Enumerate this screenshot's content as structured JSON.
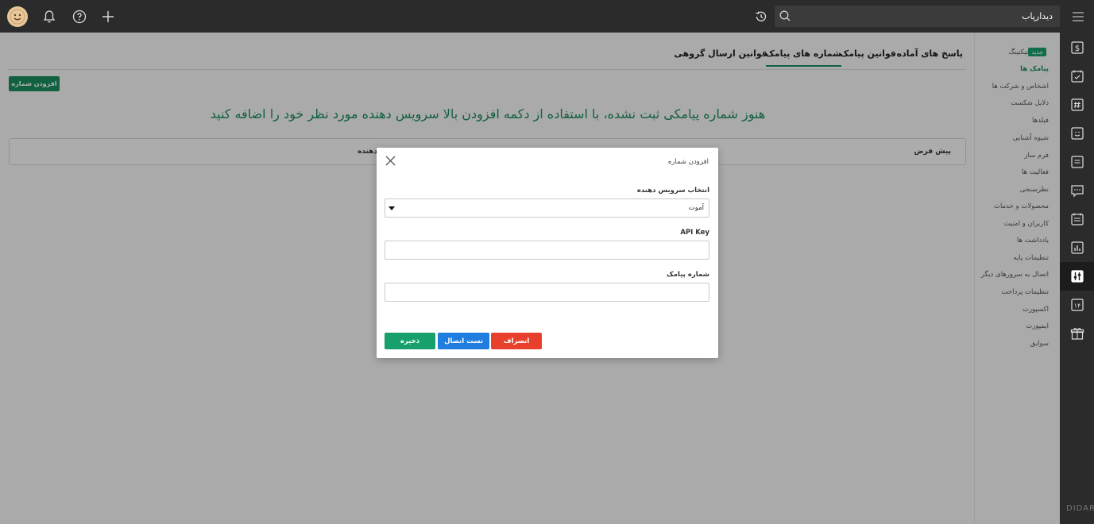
{
  "header": {
    "search_value": "دیدارپاب",
    "icons": [
      "avatar-smiley",
      "bell-icon",
      "help-icon",
      "plus-icon",
      "history-icon",
      "search-icon",
      "menu-icon"
    ]
  },
  "sidebar": {
    "items": [
      {
        "label": "تیکتینگ",
        "badge": "جدید"
      },
      {
        "label": "پیامک ها",
        "active": true
      },
      {
        "label": "اشخاص و شرکت ها"
      },
      {
        "label": "دلایل شکست"
      },
      {
        "label": "فیلدها"
      },
      {
        "label": "شیوه آشنایی"
      },
      {
        "label": "فرم ساز"
      },
      {
        "label": "فعالیت ها"
      },
      {
        "label": "نظرسنجی"
      },
      {
        "label": "محصولات و خدمات"
      },
      {
        "label": "کاربران و امنیت"
      },
      {
        "label": "یادداشت ها"
      },
      {
        "label": "تنظیمات پایه"
      },
      {
        "label": "اتصال به سرورهای دیگر"
      },
      {
        "label": "تنظیمات پرداخت"
      },
      {
        "label": "اکسپورت"
      },
      {
        "label": "ایمپورت"
      },
      {
        "label": "سوابق"
      }
    ]
  },
  "tabs": [
    {
      "label": "پاسخ های آماده"
    },
    {
      "label": "قوانین پیامک"
    },
    {
      "label": "شماره های پیامک",
      "active": true
    },
    {
      "label": "قوانین ارسال گروهی"
    }
  ],
  "main": {
    "add_button": "افزودن شماره",
    "empty_message": "هنوز شماره پیامکی ثبت نشده، با استفاده از دکمه افزودن بالا سرویس دهنده مورد نظر خود را اضافه کنید",
    "columns": [
      "پیش فرض",
      "دهنده"
    ]
  },
  "modal": {
    "title": "افزودن شماره",
    "provider_label": "انتخاب سرویس دهنده",
    "provider_value": "آموت",
    "api_key_label": "API Key",
    "api_key_value": "",
    "sms_number_label": "شماره پیامک",
    "sms_number_value": "",
    "save_label": "ذخیره",
    "test_label": "تست اتصال",
    "cancel_label": "انصراف"
  },
  "rail_brand": "DIDAR",
  "colors": {
    "accent_green": "#1b8b5c",
    "save_green": "#17a06b",
    "test_blue": "#1f7ee0",
    "cancel_red": "#e8402d",
    "topbar": "#2b2b2b"
  }
}
